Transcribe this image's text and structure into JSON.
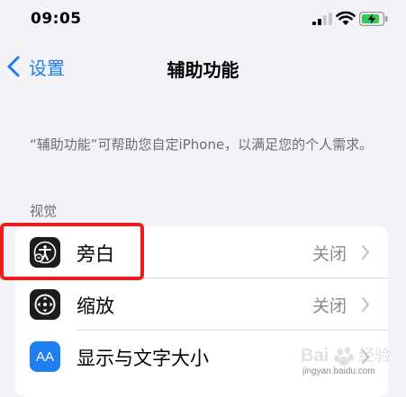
{
  "status_bar": {
    "time": "09:05"
  },
  "nav": {
    "back_label": "设置",
    "title": "辅助功能"
  },
  "description": "“辅助功能”可帮助您自定iPhone，以满足您的个人需求。",
  "section_vision": {
    "header": "视觉",
    "items": [
      {
        "label": "旁白",
        "value": "关闭",
        "icon": "voiceover-icon"
      },
      {
        "label": "缩放",
        "value": "关闭",
        "icon": "zoom-icon"
      },
      {
        "label": "显示与文字大小",
        "value": "",
        "icon": "display-text-size-icon",
        "icon_text": "AA"
      }
    ]
  },
  "watermark": {
    "text": "Baidu 经验",
    "url": "jingyan.baidu.com"
  },
  "colors": {
    "accent": "#1e7cf2",
    "highlight": "#ee1c1c",
    "battery": "#34c759"
  }
}
